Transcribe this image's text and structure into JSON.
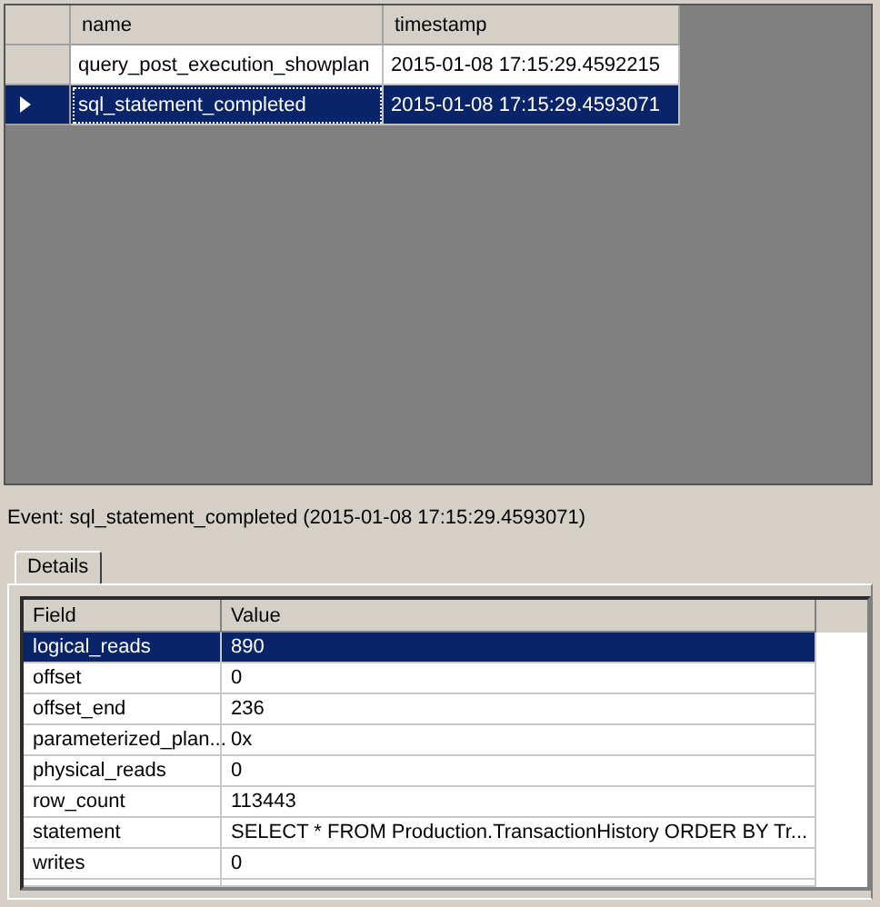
{
  "events_grid": {
    "columns": [
      "name",
      "timestamp"
    ],
    "rows": [
      {
        "name": "query_post_execution_showplan",
        "timestamp": "2015-01-08 17:15:29.4592215",
        "selected": false
      },
      {
        "name": "sql_statement_completed",
        "timestamp": "2015-01-08 17:15:29.4593071",
        "selected": true
      }
    ]
  },
  "event_title": "Event: sql_statement_completed (2015-01-08 17:15:29.4593071)",
  "tabs": [
    {
      "label": "Details",
      "selected": true
    }
  ],
  "details_grid": {
    "columns": [
      "Field",
      "Value"
    ],
    "rows": [
      {
        "field": "logical_reads",
        "value": "890",
        "selected": true
      },
      {
        "field": "offset",
        "value": "0",
        "selected": false
      },
      {
        "field": "offset_end",
        "value": "236",
        "selected": false
      },
      {
        "field": "parameterized_plan...",
        "value": "0x",
        "selected": false
      },
      {
        "field": "physical_reads",
        "value": "0",
        "selected": false
      },
      {
        "field": "row_count",
        "value": "113443",
        "selected": false
      },
      {
        "field": "statement",
        "value": "SELECT * FROM Production.TransactionHistory  ORDER BY Tr...",
        "selected": false
      },
      {
        "field": "writes",
        "value": "0",
        "selected": false
      }
    ]
  }
}
